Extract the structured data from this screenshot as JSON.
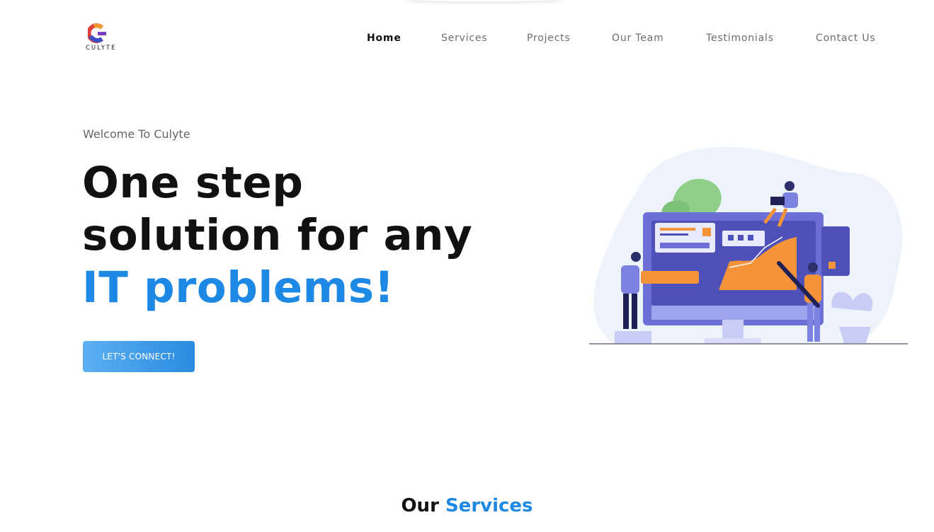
{
  "brand": {
    "name": "CULYTE"
  },
  "nav": {
    "items": [
      {
        "label": "Home",
        "active": true
      },
      {
        "label": "Services",
        "active": false
      },
      {
        "label": "Projects",
        "active": false
      },
      {
        "label": "Our Team",
        "active": false
      },
      {
        "label": "Testimonials",
        "active": false
      },
      {
        "label": "Contact Us",
        "active": false
      }
    ]
  },
  "hero": {
    "welcome": "Welcome To Culyte",
    "headline_line1": "One step",
    "headline_line2": "solution for any",
    "headline_line3": "IT problems!",
    "cta_label": "LET'S CONNECT!",
    "illustration": "designers-working-on-monitor-illustration"
  },
  "services": {
    "title_dark": "Our",
    "title_blue": "Services"
  },
  "colors": {
    "accent": "#1e88e5",
    "cta_start": "#5cb0f2",
    "cta_end": "#2a8be0",
    "text": "#111111",
    "muted": "#6d6d6d"
  }
}
